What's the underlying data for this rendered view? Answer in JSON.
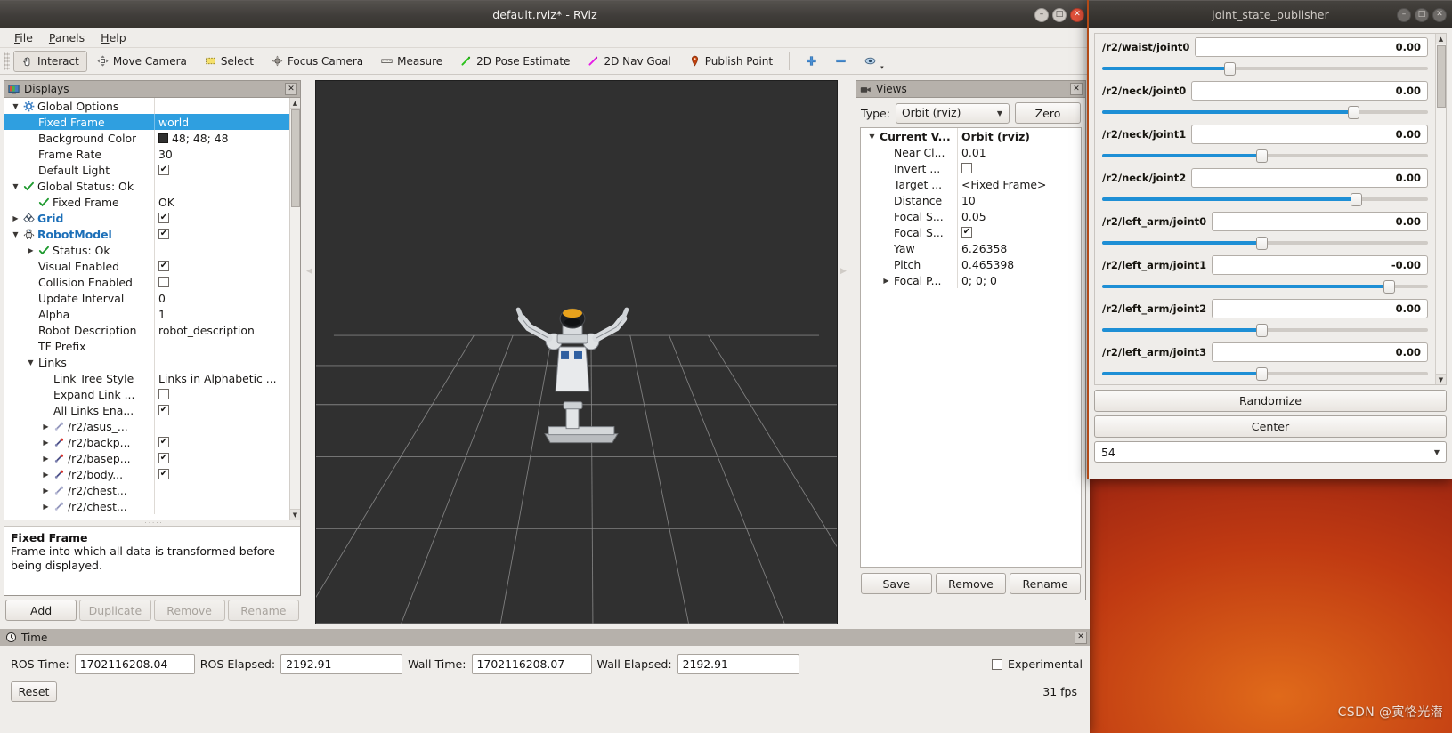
{
  "desktop": {
    "watermark": "CSDN @寅恪光潜"
  },
  "rviz": {
    "title": "default.rviz* - RViz",
    "window_buttons": {
      "minimize": "–",
      "maximize": "□",
      "close": "✕"
    },
    "menus": [
      {
        "label": "File",
        "mnemonic": "F"
      },
      {
        "label": "Panels",
        "mnemonic": "P"
      },
      {
        "label": "Help",
        "mnemonic": "H"
      }
    ],
    "toolbar": [
      {
        "label": "Interact",
        "icon": "hand-cursor-icon",
        "active": true
      },
      {
        "label": "Move Camera",
        "icon": "move-camera-icon",
        "active": false
      },
      {
        "label": "Select",
        "icon": "select-rect-icon",
        "active": false
      },
      {
        "label": "Focus Camera",
        "icon": "focus-camera-icon",
        "active": false
      },
      {
        "label": "Measure",
        "icon": "ruler-icon",
        "active": false
      },
      {
        "label": "2D Pose Estimate",
        "icon": "green-arrow-icon",
        "active": false
      },
      {
        "label": "2D Nav Goal",
        "icon": "magenta-arrow-icon",
        "active": false
      },
      {
        "label": "Publish Point",
        "icon": "map-pin-icon",
        "active": false
      }
    ],
    "toolbar_extra": [
      {
        "icon": "plus-icon",
        "label": ""
      },
      {
        "icon": "minus-icon",
        "label": ""
      },
      {
        "icon": "eye-icon",
        "label": ""
      }
    ]
  },
  "displays": {
    "panel_title": "Displays",
    "panel_icon": "displays-monitor-icon",
    "close_label": "✕",
    "rows": [
      {
        "indent": 0,
        "arrow": "down",
        "icon": "gear-icon",
        "label": "Global Options",
        "style": "plain",
        "value": "",
        "value_type": "none"
      },
      {
        "indent": 1,
        "arrow": "none",
        "icon": "",
        "label": "Fixed Frame",
        "style": "plain",
        "value": "world",
        "value_type": "text",
        "selected": true
      },
      {
        "indent": 1,
        "arrow": "none",
        "icon": "",
        "label": "Background Color",
        "style": "plain",
        "value": "48; 48; 48",
        "value_type": "swatch"
      },
      {
        "indent": 1,
        "arrow": "none",
        "icon": "",
        "label": "Frame Rate",
        "style": "plain",
        "value": "30",
        "value_type": "text"
      },
      {
        "indent": 1,
        "arrow": "none",
        "icon": "",
        "label": "Default Light",
        "style": "plain",
        "value": "checked",
        "value_type": "checkbox"
      },
      {
        "indent": 0,
        "arrow": "down",
        "icon": "green-check-icon",
        "label": "Global Status: Ok",
        "style": "plain",
        "value": "",
        "value_type": "none"
      },
      {
        "indent": 1,
        "arrow": "none",
        "icon": "green-check-icon",
        "label": "Fixed Frame",
        "style": "plain",
        "value": "OK",
        "value_type": "text"
      },
      {
        "indent": 0,
        "arrow": "right",
        "icon": "grid-icon",
        "label": "Grid",
        "style": "link",
        "value": "checked",
        "value_type": "checkbox"
      },
      {
        "indent": 0,
        "arrow": "down",
        "icon": "robot-icon",
        "label": "RobotModel",
        "style": "link",
        "value": "checked",
        "value_type": "checkbox"
      },
      {
        "indent": 1,
        "arrow": "right",
        "icon": "green-check-icon",
        "label": "Status: Ok",
        "style": "plain",
        "value": "",
        "value_type": "none"
      },
      {
        "indent": 1,
        "arrow": "none",
        "icon": "",
        "label": "Visual Enabled",
        "style": "plain",
        "value": "checked",
        "value_type": "checkbox"
      },
      {
        "indent": 1,
        "arrow": "none",
        "icon": "",
        "label": "Collision Enabled",
        "style": "plain",
        "value": "unchecked",
        "value_type": "checkbox"
      },
      {
        "indent": 1,
        "arrow": "none",
        "icon": "",
        "label": "Update Interval",
        "style": "plain",
        "value": "0",
        "value_type": "text"
      },
      {
        "indent": 1,
        "arrow": "none",
        "icon": "",
        "label": "Alpha",
        "style": "plain",
        "value": "1",
        "value_type": "text"
      },
      {
        "indent": 1,
        "arrow": "none",
        "icon": "",
        "label": "Robot Description",
        "style": "plain",
        "value": "robot_description",
        "value_type": "text"
      },
      {
        "indent": 1,
        "arrow": "none",
        "icon": "",
        "label": "TF Prefix",
        "style": "plain",
        "value": "",
        "value_type": "none"
      },
      {
        "indent": 1,
        "arrow": "down",
        "icon": "",
        "label": "Links",
        "style": "plain",
        "value": "",
        "value_type": "none"
      },
      {
        "indent": 2,
        "arrow": "none",
        "icon": "",
        "label": "Link Tree Style",
        "style": "plain",
        "value": "Links in Alphabetic ...",
        "value_type": "text"
      },
      {
        "indent": 2,
        "arrow": "none",
        "icon": "",
        "label": "Expand Link ...",
        "style": "plain",
        "value": "unchecked",
        "value_type": "checkbox"
      },
      {
        "indent": 2,
        "arrow": "none",
        "icon": "",
        "label": "All Links Ena...",
        "style": "plain",
        "value": "checked",
        "value_type": "checkbox"
      },
      {
        "indent": 2,
        "arrow": "right",
        "icon": "link-icon-gray",
        "label": "/r2/asus_...",
        "style": "plain",
        "value": "",
        "value_type": "none"
      },
      {
        "indent": 2,
        "arrow": "right",
        "icon": "link-icon-red",
        "label": "/r2/backp...",
        "style": "plain",
        "value": "checked",
        "value_type": "checkbox"
      },
      {
        "indent": 2,
        "arrow": "right",
        "icon": "link-icon-red",
        "label": "/r2/basep...",
        "style": "plain",
        "value": "checked",
        "value_type": "checkbox"
      },
      {
        "indent": 2,
        "arrow": "right",
        "icon": "link-icon-red",
        "label": "/r2/body...",
        "style": "plain",
        "value": "checked",
        "value_type": "checkbox"
      },
      {
        "indent": 2,
        "arrow": "right",
        "icon": "link-icon-gray",
        "label": "/r2/chest...",
        "style": "plain",
        "value": "",
        "value_type": "none"
      },
      {
        "indent": 2,
        "arrow": "right",
        "icon": "link-icon-gray",
        "label": "/r2/chest...",
        "style": "plain",
        "value": "",
        "value_type": "none"
      }
    ],
    "help": {
      "heading": "Fixed Frame",
      "body": "Frame into which all data is transformed before being displayed."
    },
    "buttons": [
      {
        "label": "Add",
        "enabled": true
      },
      {
        "label": "Duplicate",
        "enabled": false
      },
      {
        "label": "Remove",
        "enabled": false
      },
      {
        "label": "Rename",
        "enabled": false
      }
    ]
  },
  "views": {
    "panel_title": "Views",
    "panel_icon": "views-camera-icon",
    "close_label": "✕",
    "type_label": "Type:",
    "type_value": "Orbit (rviz)",
    "zero_button": "Zero",
    "rows": [
      {
        "indent": 0,
        "arrow": "down",
        "label": "Current V...",
        "bold": true,
        "value": "Orbit (rviz)",
        "value_type": "text"
      },
      {
        "indent": 1,
        "arrow": "none",
        "label": "Near Cl...",
        "bold": false,
        "value": "0.01",
        "value_type": "text"
      },
      {
        "indent": 1,
        "arrow": "none",
        "label": "Invert ...",
        "bold": false,
        "value": "unchecked",
        "value_type": "checkbox"
      },
      {
        "indent": 1,
        "arrow": "none",
        "label": "Target ...",
        "bold": false,
        "value": "<Fixed Frame>",
        "value_type": "text"
      },
      {
        "indent": 1,
        "arrow": "none",
        "label": "Distance",
        "bold": false,
        "value": "10",
        "value_type": "text"
      },
      {
        "indent": 1,
        "arrow": "none",
        "label": "Focal S...",
        "bold": false,
        "value": "0.05",
        "value_type": "text"
      },
      {
        "indent": 1,
        "arrow": "none",
        "label": "Focal S...",
        "bold": false,
        "value": "checked",
        "value_type": "checkbox"
      },
      {
        "indent": 1,
        "arrow": "none",
        "label": "Yaw",
        "bold": false,
        "value": "6.26358",
        "value_type": "text"
      },
      {
        "indent": 1,
        "arrow": "none",
        "label": "Pitch",
        "bold": false,
        "value": "0.465398",
        "value_type": "text"
      },
      {
        "indent": 1,
        "arrow": "right",
        "label": "Focal P...",
        "bold": false,
        "value": "0; 0; 0",
        "value_type": "text"
      }
    ],
    "buttons": [
      {
        "label": "Save"
      },
      {
        "label": "Remove"
      },
      {
        "label": "Rename"
      }
    ]
  },
  "time": {
    "panel_title": "Time",
    "panel_icon": "clock-icon",
    "close_label": "✕",
    "fields": [
      {
        "label": "ROS Time:",
        "value": "1702116208.04"
      },
      {
        "label": "ROS Elapsed:",
        "value": "2192.91"
      },
      {
        "label": "Wall Time:",
        "value": "1702116208.07"
      },
      {
        "label": "Wall Elapsed:",
        "value": "2192.91"
      }
    ],
    "experimental_label": "Experimental",
    "experimental_checked": false,
    "reset_button": "Reset",
    "fps": "31 fps"
  },
  "jsp": {
    "title": "joint_state_publisher",
    "window_buttons": {
      "minimize": "–",
      "maximize": "□",
      "close": "✕"
    },
    "joints": [
      {
        "name": "/r2/waist/joint0",
        "value": "0.00",
        "slider_pct": 39
      },
      {
        "name": "/r2/neck/joint0",
        "value": "0.00",
        "slider_pct": 77
      },
      {
        "name": "/r2/neck/joint1",
        "value": "0.00",
        "slider_pct": 49
      },
      {
        "name": "/r2/neck/joint2",
        "value": "0.00",
        "slider_pct": 78
      },
      {
        "name": "/r2/left_arm/joint0",
        "value": "0.00",
        "slider_pct": 49
      },
      {
        "name": "/r2/left_arm/joint1",
        "value": "-0.00",
        "slider_pct": 88
      },
      {
        "name": "/r2/left_arm/joint2",
        "value": "0.00",
        "slider_pct": 49
      },
      {
        "name": "/r2/left_arm/joint3",
        "value": "0.00",
        "slider_pct": 49
      }
    ],
    "randomize_button": "Randomize",
    "center_button": "Center",
    "step_value": "54"
  }
}
